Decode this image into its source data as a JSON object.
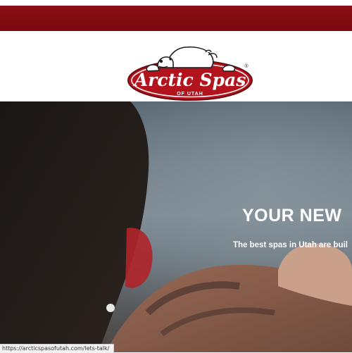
{
  "header": {
    "logo_text": "Arctic Spas",
    "logo_subtext": "OF UTAH",
    "logo_mark": "®"
  },
  "hero": {
    "title": "YOUR NEW",
    "subtitle": "The best spas in Utah are buil"
  },
  "status_bar": {
    "url": "https://arcticspasofutah.com/lets-talk/"
  },
  "colors": {
    "brand_red": "#8e0e15",
    "logo_red": "#b3131c",
    "white": "#ffffff"
  }
}
